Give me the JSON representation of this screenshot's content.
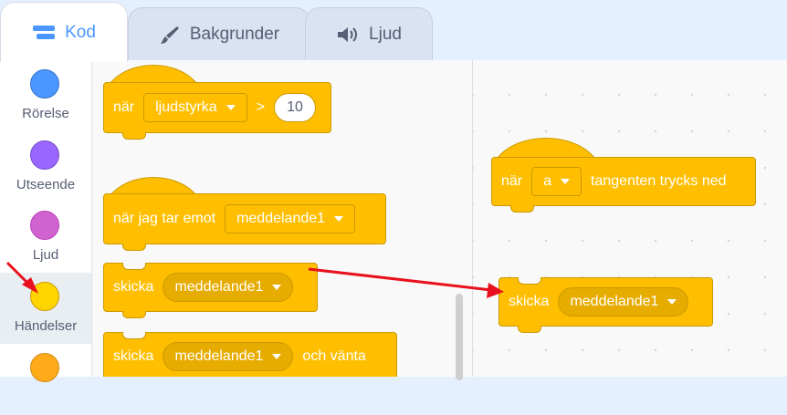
{
  "tabs": [
    {
      "label": "Kod",
      "icon": "code-icon",
      "active": true
    },
    {
      "label": "Bakgrunder",
      "icon": "paintbrush-icon",
      "active": false
    },
    {
      "label": "Ljud",
      "icon": "speaker-icon",
      "active": false
    }
  ],
  "categories": [
    {
      "label": "Rörelse",
      "color": "#4c97ff"
    },
    {
      "label": "Utseende",
      "color": "#9966ff"
    },
    {
      "label": "Ljud",
      "color": "#cf63cf"
    },
    {
      "label": "Händelser",
      "color": "#ffd500",
      "selected": true
    },
    {
      "label": "",
      "color": "#ffab19"
    }
  ],
  "palette": {
    "block_loudness": {
      "text": "när",
      "menu": "ljudstyrka",
      "operator": ">",
      "value": "10"
    },
    "block_receive": {
      "text": "när jag tar emot",
      "menu": "meddelande1"
    },
    "block_broadcast": {
      "text": "skicka",
      "menu": "meddelande1"
    },
    "block_broadcast_wait": {
      "text": "skicka",
      "menu": "meddelande1",
      "suffix": "och vänta"
    }
  },
  "workspace": {
    "block_key": {
      "text": "när",
      "key": "a",
      "suffix": "tangenten trycks ned"
    },
    "block_broadcast": {
      "text": "skicka",
      "menu": "meddelande1"
    }
  },
  "colors": {
    "events": "#ffbf00",
    "events_border": "#cc9900",
    "annotation_arrow": "#e8101c",
    "accent": "#4c97ff"
  }
}
